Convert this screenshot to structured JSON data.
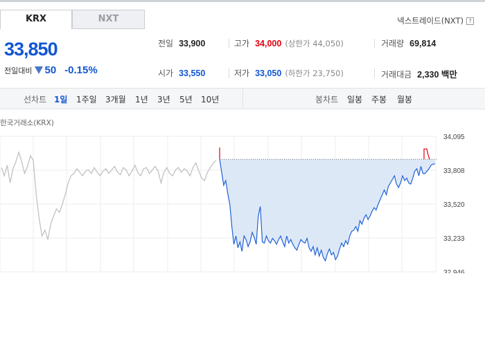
{
  "tabs": [
    {
      "label": "KRX",
      "active": true
    },
    {
      "label": "NXT",
      "active": false
    }
  ],
  "nxt_link": "넥스트레이드(NXT)",
  "help_icon": "?",
  "price": "33,850",
  "change": {
    "label": "전일대비",
    "direction_icon": "down-triangle-icon",
    "value": "50",
    "percent": "-0.15%"
  },
  "stats": {
    "prev_close": {
      "label": "전일",
      "value": "33,900"
    },
    "high": {
      "label": "고가",
      "value": "34,000",
      "sub": "(상한가 44,050)"
    },
    "volume": {
      "label": "거래량",
      "value": "69,814"
    },
    "open": {
      "label": "시가",
      "value": "33,550"
    },
    "low": {
      "label": "저가",
      "value": "33,050",
      "sub": "(하한가 23,750)"
    },
    "amount": {
      "label": "거래대금",
      "value": "2,330 백만"
    }
  },
  "chart_bar": {
    "line_chart_label": "선차트",
    "periods": [
      "1일",
      "1주일",
      "3개월",
      "1년",
      "3년",
      "5년",
      "10년"
    ],
    "active_period": "1일",
    "candle_chart_label": "봉차트",
    "candle_periods": [
      "일봉",
      "주봉",
      "월봉"
    ]
  },
  "exchange_label": "한국거래소(KRX)",
  "colors": {
    "up": "#e3000f",
    "down": "#1156d2",
    "area": "#dde8f7",
    "gray_line": "#bdbdbd"
  },
  "chart_data": {
    "type": "line",
    "y_ticks": [
      "34,095",
      "33,808",
      "33,520",
      "33,233",
      "32,946"
    ],
    "ylim": [
      32946,
      34095
    ],
    "prev_close": 33900,
    "prev_day_series": [
      33830,
      33760,
      33850,
      33700,
      33820,
      33880,
      33960,
      33880,
      33780,
      33840,
      33930,
      33890,
      33600,
      33400,
      33250,
      33300,
      33220,
      33350,
      33420,
      33480,
      33450,
      33520,
      33600,
      33700,
      33760,
      33780,
      33820,
      33790,
      33760,
      33800,
      33810,
      33780,
      33830,
      33790,
      33760,
      33800,
      33820,
      33780,
      33810,
      33840,
      33790,
      33770,
      33830,
      33810,
      33760,
      33800,
      33850,
      33790,
      33760,
      33820,
      33830,
      33780,
      33810,
      33840,
      33800,
      33700,
      33790,
      33830,
      33780,
      33760,
      33810,
      33830,
      33790,
      33820,
      33800,
      33760,
      33830,
      33870,
      33800,
      33740,
      33720,
      33790,
      33830,
      33870,
      33890
    ],
    "today_series": [
      33900,
      33790,
      33680,
      33720,
      33610,
      33520,
      33330,
      33180,
      33250,
      33150,
      33200,
      33120,
      33250,
      33220,
      33160,
      33200,
      33280,
      33240,
      33180,
      33420,
      33500,
      33200,
      33190,
      33250,
      33210,
      33190,
      33230,
      33210,
      33180,
      33220,
      33250,
      33200,
      33160,
      33250,
      33190,
      33220,
      33180,
      33150,
      33130,
      33180,
      33220,
      33200,
      33190,
      33230,
      33150,
      33120,
      33160,
      33090,
      33150,
      33080,
      33130,
      33070,
      33040,
      33100,
      33140,
      33090,
      33110,
      33050,
      33080,
      33140,
      33190,
      33160,
      33210,
      33180,
      33250,
      33290,
      33300,
      33330,
      33290,
      33380,
      33350,
      33400,
      33430,
      33390,
      33420,
      33460,
      33490,
      33470,
      33520,
      33560,
      33600,
      33640,
      33600,
      33670,
      33700,
      33730,
      33760,
      33690,
      33660,
      33700,
      33760,
      33720,
      33740,
      33700,
      33690,
      33740,
      33800,
      33820,
      33760,
      33840,
      33780,
      33780,
      33800,
      33820,
      33850,
      33860,
      33860
    ],
    "today_spike_up_at_open": 34000,
    "last_tick": "34,000"
  }
}
